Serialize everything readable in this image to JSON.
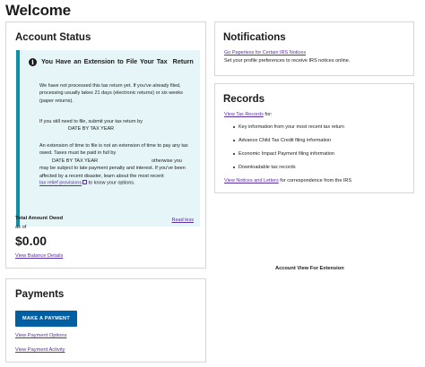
{
  "page": {
    "title": "Welcome"
  },
  "account_status": {
    "heading": "Account Status",
    "alert": {
      "title": "You Have an Extension to File Your Tax  Return",
      "para1": "We have not processed this tax return yet. If you've already filed, processing usually takes 21 days (electronic returns) or six weeks (paper returns).",
      "para2": "If you still need to file, submit your tax return by",
      "date1": "DATE BY TAX YEAR",
      "para3_a": "An extension of time to file is not an extension of time to pay any tax owed. Taxes must be paid in full by",
      "date2": "DATE BY TAX YEAR",
      "para3_b": "otherwise you may be subject to late payment penalty and interest. If you've been affected by a recent disaster, learn about the most recent",
      "relief_link": "tax relief provisions",
      "para3_c": "to know your options.",
      "read_less": "Read less"
    },
    "owed_label": "Total Amount Owed",
    "as_of": "as of",
    "amount": "$0.00",
    "view_balance": "View Balance Details"
  },
  "notifications": {
    "heading": "Notifications",
    "go_paperless": "Go Paperless for Certain IRS Notices",
    "preferences_text": "Set your profile preferences to receive IRS notices online."
  },
  "records": {
    "heading": "Records",
    "view_tax_records": "View Tax Records",
    "intro_suffix": "for:",
    "items": [
      "Key information from your most recent tax return",
      "Advance Child Tax Credit filing information",
      "Economic Impact Payment filing information",
      "Downloadable tax records"
    ],
    "notices_link": "View Notices and Letters",
    "notices_suffix": "for correspondence from the IRS"
  },
  "caption": "Account View For Extension",
  "payments": {
    "heading": "Payments",
    "make_payment": "MAKE A PAYMENT",
    "payment_options": "View Payment Options",
    "payment_activity": "View Payment Activity"
  },
  "icons": {
    "alert": "info-icon",
    "external": "external-link-icon"
  },
  "colors": {
    "alert_bg": "#e5f5f8",
    "alert_border": "#0f8fa6",
    "link": "#5a2fa0",
    "button": "#005ea2"
  }
}
